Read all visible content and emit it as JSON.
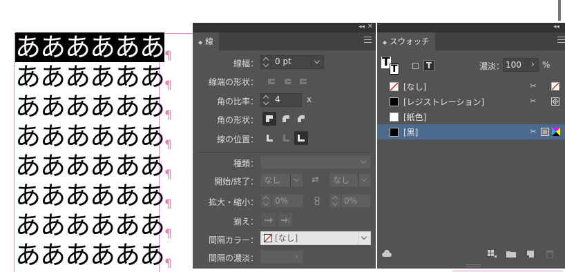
{
  "document": {
    "text_lines": [
      {
        "text": "ああああああ",
        "selected": true
      },
      {
        "text": "ああああああ",
        "selected": false
      },
      {
        "text": "ああああああ",
        "selected": false
      },
      {
        "text": "ああああああ",
        "selected": false
      },
      {
        "text": "ああああああ",
        "selected": false
      },
      {
        "text": "ああああああ",
        "selected": false
      },
      {
        "text": "ああああああ",
        "selected": false
      },
      {
        "text": "ああああああ",
        "selected": false
      }
    ],
    "pilcrow": "¶"
  },
  "stroke_panel": {
    "tab_label": "線",
    "collapse_glyph": "◂◂",
    "close_glyph": "✕",
    "weight_label": "線幅：",
    "weight_value": "0 pt",
    "cap_label": "線端の形状：",
    "miter_label": "角の比率：",
    "miter_value": "4",
    "miter_unit": "x",
    "join_label": "角の形状：",
    "align_label": "線の位置：",
    "type_label": "種類：",
    "type_value": "",
    "start_end_label": "開始/終了：",
    "start_value": "なし",
    "end_value": "なし",
    "swap_glyph": "⇄",
    "scale_label": "拡大・縮小：",
    "scale_start": "0%",
    "scale_end": "0%",
    "align_arrows_label": "揃え：",
    "gap_color_label": "間隔カラー：",
    "gap_color_value": "[なし]",
    "gap_tint_label": "間隔の濃淡：",
    "gap_tint_value": ""
  },
  "swatches_panel": {
    "tab_label": "スウォッチ",
    "tint_label": "濃淡：",
    "tint_value": "100",
    "tint_unit": "%",
    "text_format_glyph": "T",
    "items": [
      {
        "name": "[なし]",
        "chip": "none"
      },
      {
        "name": "[レジストレーション]",
        "chip": "#000000"
      },
      {
        "name": "[紙色]",
        "chip": "#ffffff"
      },
      {
        "name": "[黒]",
        "chip": "#000000",
        "selected": true
      }
    ],
    "colors": {
      "selected_row": "#4b6a8e",
      "panel_bg": "#535353"
    }
  }
}
